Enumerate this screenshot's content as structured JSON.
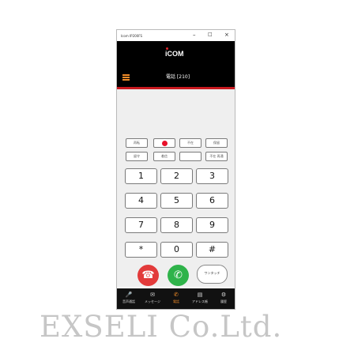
{
  "window": {
    "title": "Icom IP200FS",
    "minimize": "–",
    "maximize": "□",
    "close": "×"
  },
  "header": {
    "logo": "iCOM",
    "call_title": "電話 [210]"
  },
  "function_keys": [
    [
      "再転",
      "●",
      "不在",
      "保留"
    ],
    [
      "留守",
      "着信",
      "",
      "不在 再通"
    ]
  ],
  "keypad": [
    [
      "1",
      "2",
      "3"
    ],
    [
      "4",
      "5",
      "6"
    ],
    [
      "7",
      "8",
      "9"
    ],
    [
      "*",
      "0",
      "#"
    ]
  ],
  "actions": {
    "hangup_icon": "☎",
    "call_icon": "✆",
    "onetouch_label": "ワンタッチ"
  },
  "tabs": [
    {
      "icon": "🎤",
      "label": "音声通話"
    },
    {
      "icon": "✉",
      "label": "メッセージ"
    },
    {
      "icon": "✆",
      "label": "電話"
    },
    {
      "icon": "▤",
      "label": "アドレス帳"
    },
    {
      "icon": "⚙",
      "label": "履歴"
    }
  ],
  "colors": {
    "accent": "#f28c28",
    "header_bg": "#000000",
    "hangup": "#e23a3a",
    "call": "#2fb34a",
    "divider": "#c9191f"
  },
  "watermark": "EXSELI Co.Ltd."
}
